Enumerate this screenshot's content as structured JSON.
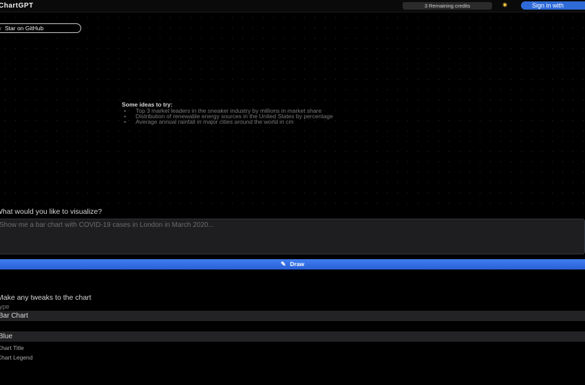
{
  "header": {
    "logo": "ChartGPT",
    "credits": "3 Remaining credits",
    "theme_icon": "sun-icon",
    "signin": "Sign in with"
  },
  "github": {
    "icon": "star-icon",
    "label": "Star on GitHub"
  },
  "ideas": {
    "title": "Some ideas to try:",
    "items": [
      "Top 3 market leaders in the sneaker industry by millions in market share",
      "Distribution of renewable energy sources in the United States by percentage",
      "Average annual rainfall in major cities around the world in cm"
    ]
  },
  "prompt": {
    "label": "What would you like to visualize?",
    "placeholder": "Show me a bar chart with COVID-19 cases in London in March 2020..."
  },
  "draw": {
    "icon": "pencil-icon",
    "label": "Draw"
  },
  "tweaks": {
    "title": "Make any tweaks to the chart",
    "type_label": "Type",
    "type_value": "Bar Chart",
    "color_value": "Blue",
    "show_title": "Chart Title",
    "show_legend": "Chart Legend"
  },
  "colors": {
    "accent": "#2f6bd8",
    "draw_button": "#3a78ea",
    "background": "#000000"
  }
}
